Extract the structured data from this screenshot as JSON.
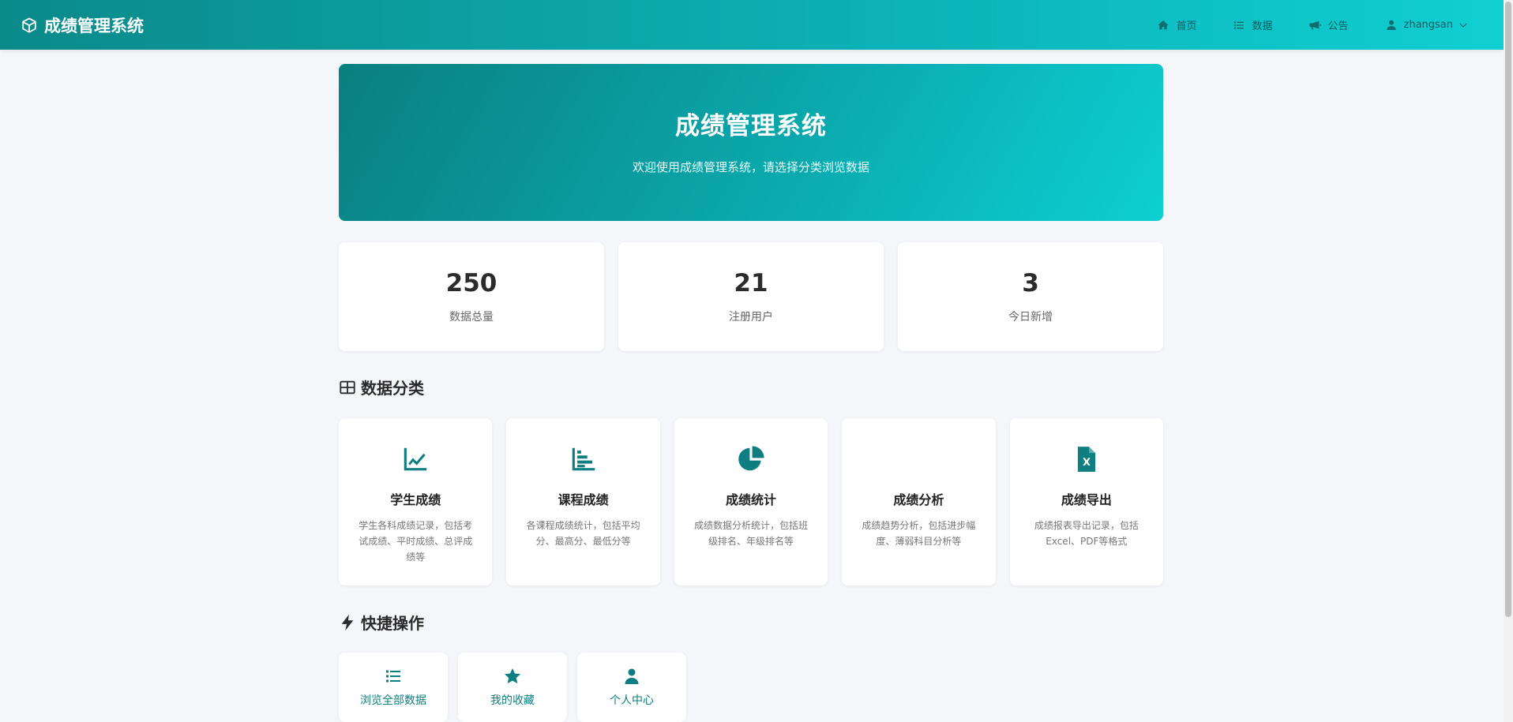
{
  "app": {
    "title": "成绩管理系统",
    "brand_icon": "cube-icon"
  },
  "nav": {
    "items": [
      {
        "label": "首页",
        "icon": "home-icon"
      },
      {
        "label": "数据",
        "icon": "list-icon"
      },
      {
        "label": "公告",
        "icon": "bullhorn-icon"
      },
      {
        "label": "zhangsan",
        "icon": "user-icon"
      }
    ]
  },
  "hero": {
    "title": "成绩管理系统",
    "subtitle": "欢迎使用成绩管理系统，请选择分类浏览数据"
  },
  "stats": [
    {
      "value": "250",
      "label": "数据总量"
    },
    {
      "value": "21",
      "label": "注册用户"
    },
    {
      "value": "3",
      "label": "今日新增"
    }
  ],
  "categories_section": {
    "title": "数据分类",
    "icon": "grid-icon"
  },
  "categories": [
    {
      "title": "学生成绩",
      "desc": "学生各科成绩记录，包括考试成绩、平时成绩、总评成绩等",
      "icon": "line-chart-icon"
    },
    {
      "title": "课程成绩",
      "desc": "各课程成绩统计，包括平均分、最高分、最低分等",
      "icon": "bar-chart-icon"
    },
    {
      "title": "成绩统计",
      "desc": "成绩数据分析统计，包括班级排名、年级排名等",
      "icon": "pie-chart-icon"
    },
    {
      "title": "成绩分析",
      "desc": "成绩趋势分析，包括进步幅度、薄弱科目分析等",
      "icon": ""
    },
    {
      "title": "成绩导出",
      "desc": "成绩报表导出记录，包括Excel、PDF等格式",
      "icon": "excel-file-icon"
    }
  ],
  "quick_section": {
    "title": "快捷操作",
    "icon": "bolt-icon"
  },
  "quick_actions": [
    {
      "label": "浏览全部数据",
      "icon": "list-icon"
    },
    {
      "label": "我的收藏",
      "icon": "star-icon"
    },
    {
      "label": "个人中心",
      "icon": "user-icon"
    }
  ],
  "colors": {
    "accent": "#0f7e80",
    "nav_gradient_start": "#0b8a8a",
    "nav_gradient_end": "#10cfd2"
  }
}
